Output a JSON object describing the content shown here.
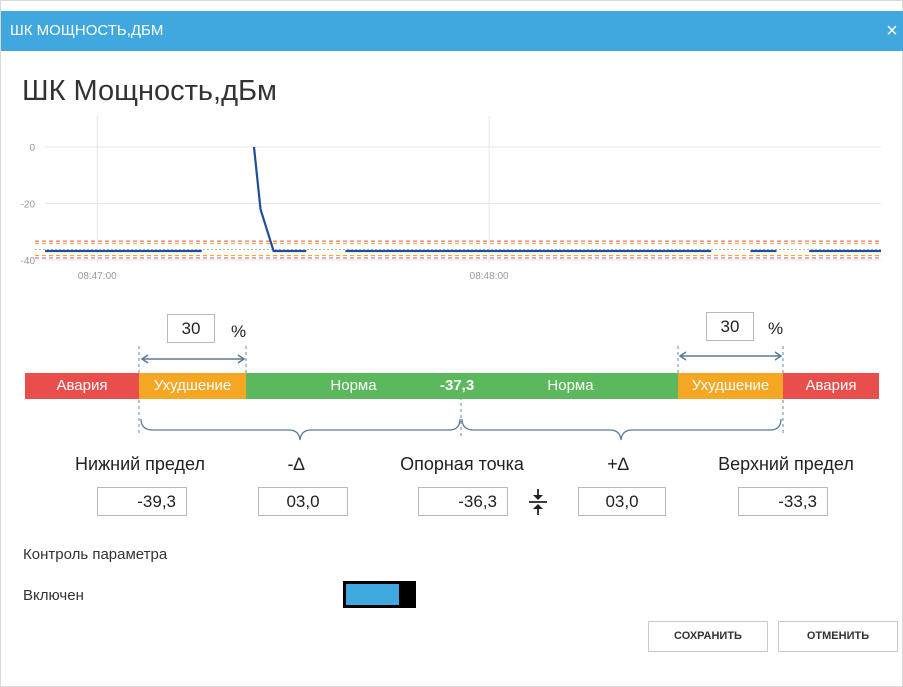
{
  "window": {
    "title": "ШК МОЩНОСТЬ,ДБМ",
    "close": "×"
  },
  "heading": "ШК Мощность,дБм",
  "chart_data": {
    "type": "line",
    "title": "",
    "xlabel": "",
    "ylabel": "",
    "ylim": [
      -40,
      2
    ],
    "x_ticks": [
      "08:47:00",
      "08:48:00"
    ],
    "y_ticks": [
      "0",
      "-20",
      "-40"
    ],
    "grid": true,
    "reference_lines": {
      "lower_alarm": -39.3,
      "lower_warning": -38.4,
      "reference": -36.3,
      "upper_warning": -34.2,
      "upper_alarm": -33.3
    },
    "series": [
      {
        "segments": [
          [
            [
              "08:46:52",
              -36.8
            ],
            [
              "08:47:16",
              -36.8
            ]
          ],
          [
            [
              "08:47:24",
              0
            ],
            [
              "08:47:25",
              -22
            ],
            [
              "08:47:27",
              -36.8
            ],
            [
              "08:47:32",
              -36.8
            ]
          ],
          [
            [
              "08:47:38",
              -36.8
            ],
            [
              "08:48:34",
              -36.8
            ]
          ],
          [
            [
              "08:48:40",
              -36.8
            ],
            [
              "08:48:44",
              -36.8
            ]
          ],
          [
            [
              "08:48:49",
              -36.8
            ],
            [
              "08:49:00",
              -36.8
            ]
          ]
        ]
      }
    ]
  },
  "bands": {
    "alarm_left": "Авария",
    "warning_left": "Ухудшение",
    "norm_left": "Норма",
    "ref_value": "-37,3",
    "norm_right": "Норма",
    "warning_right": "Ухудшение",
    "alarm_right": "Авария"
  },
  "percent": {
    "left_value": "30",
    "right_value": "30",
    "sign": "%"
  },
  "colors": {
    "title_bar": "#41a7df",
    "alarm": "#e84f4c",
    "warning": "#f5a623",
    "norm": "#5cb85c",
    "line": "#1f4e9c",
    "toggle": "#3fa9e0"
  },
  "limits": {
    "lower_label": "Нижний предел",
    "minus_delta_label": "-∆",
    "reference_label": "Опорная точка",
    "plus_delta_label": "+∆",
    "upper_label": "Верхний предел",
    "lower_value": "-39,3",
    "minus_delta_value": "03,0",
    "reference_value": "-36,3",
    "plus_delta_value": "03,0",
    "upper_value": "-33,3",
    "link_icon": "compress-arrows-icon"
  },
  "control": {
    "section_label": "Контроль параметра",
    "enabled_label": "Включен",
    "enabled": true
  },
  "buttons": {
    "save": "СОХРАНИТЬ",
    "cancel": "ОТМЕНИТЬ"
  }
}
